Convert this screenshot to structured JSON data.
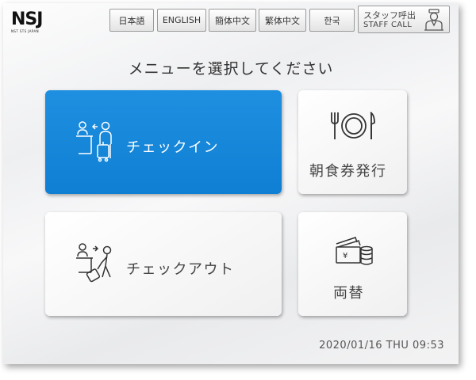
{
  "logo": {
    "text": "NSJ",
    "subtext": "NST STS JAPAN"
  },
  "languages": [
    "日本語",
    "ENGLISH",
    "簡体中文",
    "繁体中文",
    "한국"
  ],
  "staff_call": {
    "label_jp": "スタッフ呼出",
    "label_en": "STAFF CALL",
    "icon": "concierge-icon"
  },
  "prompt": "メニューを選択してください",
  "menu": {
    "checkin": {
      "label": "チェックイン",
      "icon": "checkin-icon"
    },
    "breakfast": {
      "label": "朝食券発行",
      "icon": "plate-cutlery-icon"
    },
    "checkout": {
      "label": "チェックアウト",
      "icon": "checkout-icon"
    },
    "exchange": {
      "label": "両替",
      "icon": "money-exchange-icon"
    }
  },
  "datetime": "2020/01/16 THU 09:53",
  "colors": {
    "accent": "#1a8ad9",
    "background": "#f2f2f3",
    "text": "#333333"
  }
}
